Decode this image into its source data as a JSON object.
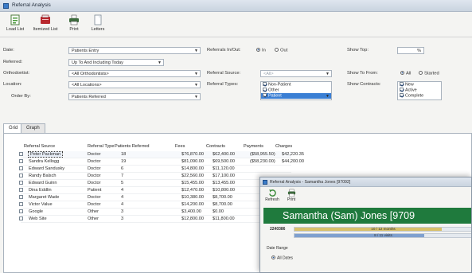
{
  "window": {
    "title": "Referral Analysis"
  },
  "toolbar": {
    "items": [
      {
        "label": "Load List"
      },
      {
        "label": "Itemized List"
      },
      {
        "label": "Print"
      },
      {
        "label": "Letters"
      }
    ]
  },
  "filters": {
    "date_label": "Date:",
    "date_value": "Patients Entry",
    "referred_label": "Referred:",
    "referred_value": "Up To And Including Today",
    "orthodontist_label": "Orthodontist:",
    "orthodontist_value": "<All Orthodontists>",
    "location_label": "Location:",
    "location_value": "<All Locations>",
    "order_label": "Order By:",
    "order_value": "Patients Referred",
    "referrals_label": "Referrals In/Out:",
    "radio_in": "In",
    "radio_out": "Out",
    "source_label": "Referral Source:",
    "source_value": "<All>",
    "types_label": "Referral Types:",
    "types_options": [
      "Non-Patient",
      "Other",
      "Patient"
    ],
    "show_top_label": "Show Top:",
    "show_top_value": "%",
    "show_to_from_label": "Show To From:",
    "radio_all": "All",
    "radio_started": "Started",
    "show_contracts_label": "Show Contracts:",
    "contracts_options": [
      "New",
      "Active",
      "Complete"
    ]
  },
  "tabs": [
    {
      "label": "Grid"
    },
    {
      "label": "Graph"
    }
  ],
  "grid": {
    "columns": [
      "Referral Source",
      "Referral Type",
      "Patients Referred",
      "Fees",
      "Contracts",
      "Payments",
      "Charges"
    ],
    "rows": [
      [
        "Peter Packman",
        "Doctor",
        "18",
        "$76,870.00",
        "$62,400.00",
        "($58,955.50)",
        "$42,220.35"
      ],
      [
        "Sandra Kellogg",
        "Doctor",
        "19",
        "$81,090.00",
        "$69,500.00",
        "($58,230.00)",
        "$44,200.00"
      ],
      [
        "Edward Sandusky",
        "Doctor",
        "6",
        "$14,800.00",
        "$11,120.00",
        "",
        ""
      ],
      [
        "Randy Balsch",
        "Doctor",
        "7",
        "$22,560.00",
        "$17,100.00",
        "",
        ""
      ],
      [
        "Edward Guinn",
        "Doctor",
        "5",
        "$15,455.00",
        "$13,455.00",
        "",
        ""
      ],
      [
        "Dina Eddlin",
        "Patient",
        "4",
        "$12,470.00",
        "$10,800.00",
        "",
        ""
      ],
      [
        "Margaret Wade",
        "Doctor",
        "4",
        "$10,380.00",
        "$8,700.00",
        "",
        ""
      ],
      [
        "Victor Value",
        "Doctor",
        "4",
        "$14,200.00",
        "$8,700.00",
        "",
        ""
      ],
      [
        "Google",
        "Other",
        "3",
        "$3,400.00",
        "$0.00",
        "",
        ""
      ],
      [
        "Web Site",
        "Other",
        "3",
        "$12,800.00",
        "$11,800.00",
        "",
        ""
      ]
    ]
  },
  "popup": {
    "title": "Referral Analysis - Samantha Jones [97092]",
    "btn_refresh": "Refresh",
    "btn_print": "Print",
    "banner": "Samantha (Sam) Jones [9709",
    "code": "2240386",
    "progress_1": {
      "text": "10 / 12 months",
      "fraction": 0.83
    },
    "progress_2": {
      "text": "8 / 11 visits",
      "fraction": 0.73
    },
    "date_range": "Date Range",
    "all_dates": "All Dates"
  },
  "colors": {
    "banner": "#1f7a3d",
    "selection": "#3b7fd4",
    "progress_1": "#d8c06a",
    "progress_2": "#7fa0cf"
  }
}
